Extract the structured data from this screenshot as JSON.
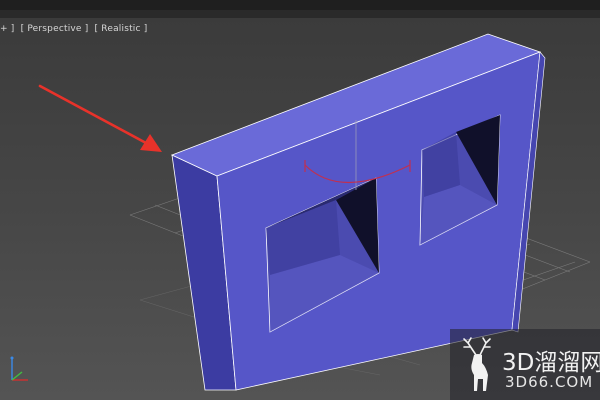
{
  "viewport": {
    "labels": [
      "+ ]",
      "[ Perspective ]",
      "[ Realistic ]"
    ]
  },
  "watermark": {
    "title": "3D溜溜网",
    "subtitle": "3D66.COM"
  },
  "colors": {
    "object_front": "#5656c8",
    "object_top": "#6a6ad8",
    "object_side": "#3a3a9a",
    "grid": "#8a8a8a",
    "annotation_arrow": "#e8322a",
    "gizmo": "#c03050"
  },
  "icons": {
    "annotation": "red-arrow-icon",
    "axis": "axis-tripod-icon",
    "logo": "deer-logo-icon"
  }
}
